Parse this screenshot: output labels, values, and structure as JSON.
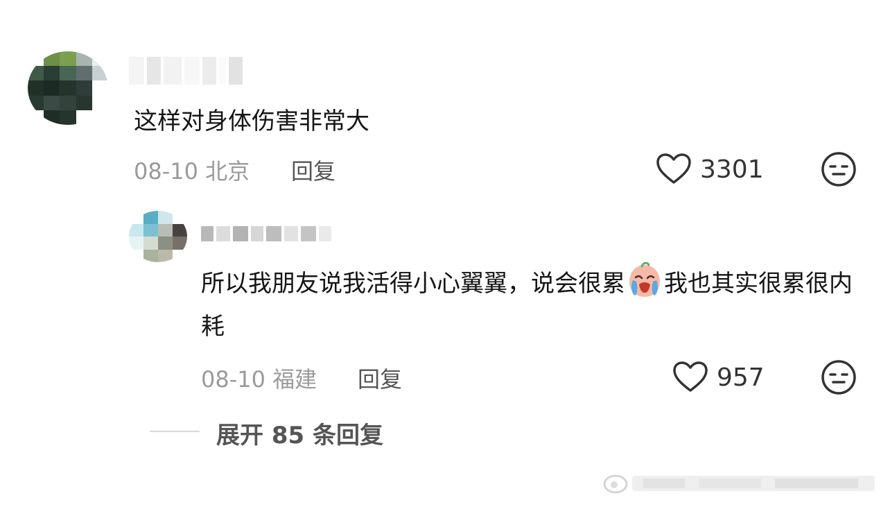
{
  "comments": [
    {
      "text": "这样对身体伤害非常大",
      "date": "08-10",
      "location": "北京",
      "reply_label": "回复",
      "likes": "3301"
    },
    {
      "text_before_emoji": "所以我朋友说我活得小心翼翼，说会很累",
      "emoji": "crying-face",
      "text_after_emoji": "我也其实很累很内耗",
      "date": "08-10",
      "location": "福建",
      "reply_label": "回复",
      "likes": "957"
    }
  ],
  "expand_replies": "展开 85 条回复",
  "icons": {
    "like": "heart-outline-icon",
    "dislike": "neutral-face-icon"
  },
  "colors": {
    "text": "#151515",
    "meta": "#9a9a9a",
    "link": "#555555"
  }
}
